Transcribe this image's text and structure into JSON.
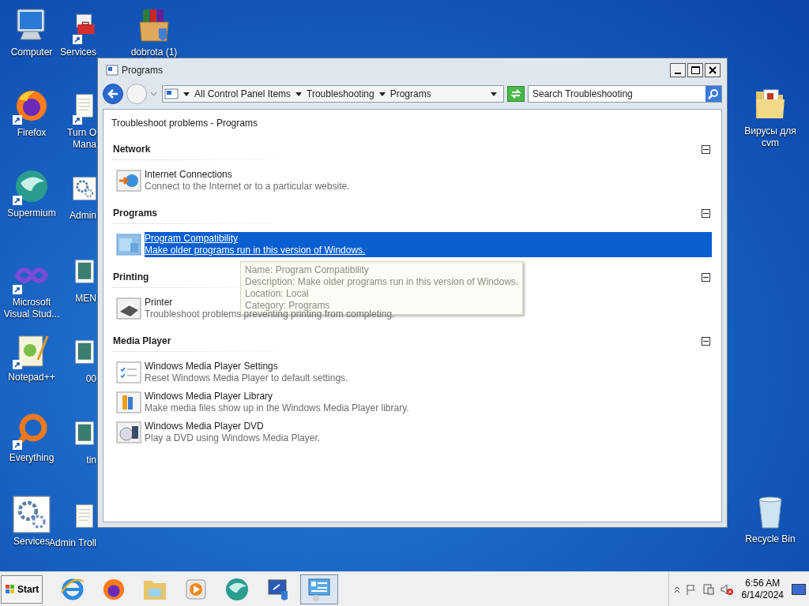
{
  "desktop_icons": [
    {
      "label": "Computer",
      "kind": "computer",
      "shortcut": false
    },
    {
      "label": "Services",
      "kind": "toolbox",
      "shortcut": true
    },
    {
      "label": "dobrota (1)",
      "kind": "package",
      "shortcut": false
    },
    {
      "label": "Firefox",
      "kind": "firefox",
      "shortcut": true
    },
    {
      "label": "Turn O\nMana",
      "kind": "document",
      "shortcut": true
    },
    {
      "label": "Supermium",
      "kind": "supermium",
      "shortcut": true
    },
    {
      "label": "Admin",
      "kind": "gears",
      "shortcut": false
    },
    {
      "label": "Microsoft\nVisual Stud...",
      "kind": "visualstudio",
      "shortcut": true
    },
    {
      "label": "MEN",
      "kind": "thumbnail",
      "shortcut": false
    },
    {
      "label": "Notepad++",
      "kind": "notepad",
      "shortcut": true
    },
    {
      "label": "00",
      "kind": "thumbnail",
      "shortcut": false
    },
    {
      "label": "Everything",
      "kind": "everything",
      "shortcut": true
    },
    {
      "label": "tin",
      "kind": "thumbnail",
      "shortcut": false
    },
    {
      "label": "Services",
      "kind": "gears",
      "shortcut": false
    },
    {
      "label": "Admin Troll",
      "kind": "document",
      "shortcut": false
    },
    {
      "label": "Вирусы для\ncvm",
      "kind": "folder",
      "shortcut": false
    },
    {
      "label": "Recycle Bin",
      "kind": "recycle",
      "shortcut": false
    }
  ],
  "window": {
    "title": "Programs",
    "breadcrumb": [
      "All Control Panel Items",
      "Troubleshooting",
      "Programs"
    ],
    "search": {
      "placeholder": "Search Troubleshooting"
    },
    "heading": "Troubleshoot problems - Programs",
    "groups": [
      {
        "title": "Network",
        "expanded": true,
        "items": [
          {
            "name": "Internet Connections",
            "description": "Connect to the Internet or to a particular website.",
            "kind": "network",
            "selected": false
          }
        ]
      },
      {
        "title": "Programs",
        "expanded": true,
        "items": [
          {
            "name": "Program Compatibility",
            "description": "Make older programs run in this version of Windows.",
            "kind": "compat",
            "selected": true
          }
        ]
      },
      {
        "title": "Printing",
        "expanded": true,
        "items": [
          {
            "name": "Printer",
            "description": "Troubleshoot problems preventing printing from completing.",
            "kind": "printer",
            "selected": false
          }
        ]
      },
      {
        "title": "Media Player",
        "expanded": true,
        "items": [
          {
            "name": "Windows Media Player Settings",
            "description": "Reset Windows Media Player to default settings.",
            "kind": "settings",
            "selected": false
          },
          {
            "name": "Windows Media Player Library",
            "description": "Make media files show up in the Windows Media Player library.",
            "kind": "library",
            "selected": false
          },
          {
            "name": "Windows Media Player DVD",
            "description": "Play a DVD using Windows Media Player.",
            "kind": "dvd",
            "selected": false
          }
        ]
      }
    ],
    "tooltip": [
      "Name: Program Compatibility",
      "Description: Make older programs run in this version of Windows.",
      "Location: Local",
      "Category: Programs"
    ]
  },
  "taskbar": {
    "start": "Start",
    "apps": [
      {
        "kind": "ie",
        "selected": false
      },
      {
        "kind": "firefox",
        "selected": false
      },
      {
        "kind": "explorer",
        "selected": false
      },
      {
        "kind": "media",
        "selected": false
      },
      {
        "kind": "supermium",
        "selected": false
      },
      {
        "kind": "remote",
        "selected": false
      },
      {
        "kind": "controlpanel",
        "selected": true
      }
    ],
    "time": "6:56 AM",
    "date": "6/14/2024"
  }
}
